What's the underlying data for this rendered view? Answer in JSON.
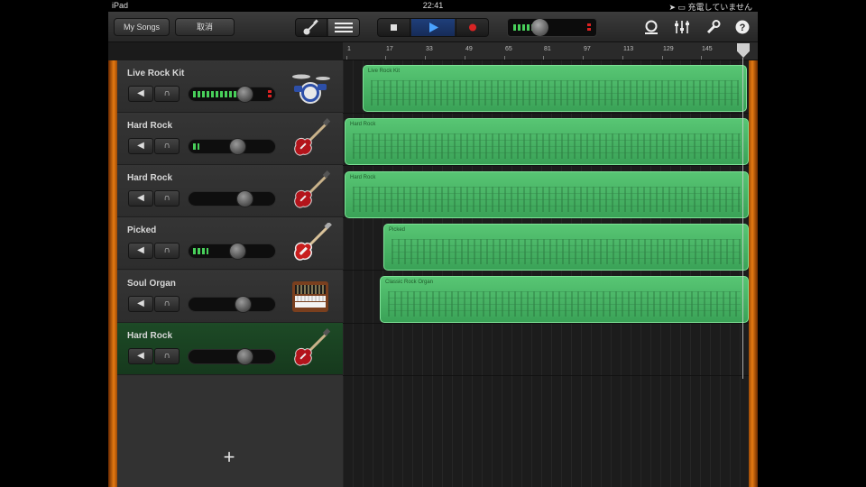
{
  "status_bar": {
    "device": "iPad",
    "time": "22:41",
    "charging": "充電していません"
  },
  "toolbar": {
    "my_songs_label": "My Songs",
    "undo_label": "取消",
    "icons": [
      "instrument-guitar-icon",
      "tracks-view-icon",
      "stop-icon",
      "play-icon",
      "record-icon",
      "loop-browser-icon",
      "mixer-icon",
      "settings-wrench-icon",
      "help-icon"
    ]
  },
  "ruler": {
    "ticks": [
      "1",
      "17",
      "33",
      "49",
      "65",
      "81",
      "97",
      "113",
      "129",
      "145"
    ]
  },
  "tracks": [
    {
      "name": "Live Rock Kit",
      "meter": 0.7,
      "volume": 0.65,
      "instrument": "drum-kit-icon",
      "selected": false
    },
    {
      "name": "Hard Rock",
      "meter": 0.08,
      "volume": 0.55,
      "instrument": "electric-guitar-icon",
      "selected": false
    },
    {
      "name": "Hard Rock",
      "meter": 0.0,
      "volume": 0.65,
      "instrument": "electric-guitar-icon",
      "selected": false
    },
    {
      "name": "Picked",
      "meter": 0.2,
      "volume": 0.55,
      "instrument": "bass-guitar-icon",
      "selected": false
    },
    {
      "name": "Soul Organ",
      "meter": 0.0,
      "volume": 0.62,
      "instrument": "organ-icon",
      "selected": false
    },
    {
      "name": "Hard Rock",
      "meter": 0.0,
      "volume": 0.65,
      "instrument": "electric-guitar-icon",
      "selected": true
    }
  ],
  "regions": [
    {
      "label": "Live Rock Kit"
    },
    {
      "label": "Hard Rock"
    },
    {
      "label": "Hard Rock"
    },
    {
      "label": "Picked"
    },
    {
      "label": "Classic Rock Organ"
    }
  ],
  "add_track_label": "+"
}
